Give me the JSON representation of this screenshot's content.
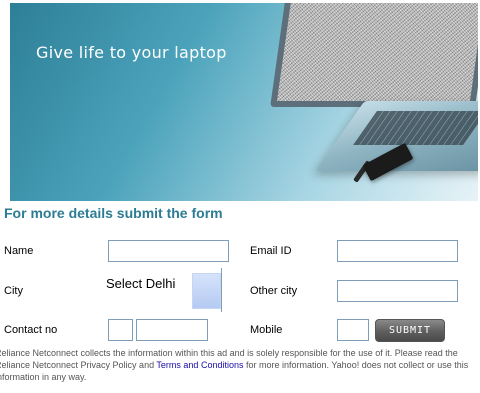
{
  "banner": {
    "title": "Give life to your laptop"
  },
  "form": {
    "heading": "For more details submit the form",
    "name_label": "Name",
    "email_label": "Email ID",
    "city_label": "City",
    "city_select_value": "Select Delhi",
    "other_city_label": "Other city",
    "contact_label": "Contact no",
    "mobile_label": "Mobile",
    "submit_label": "SUBMIT"
  },
  "disclaimer": {
    "text_before_link": "Reliance Netconnect collects the information within this ad and is solely responsible for the use of it. Please read the Reliance Netconnect Privacy Policy and ",
    "link_text": "Terms and Conditions",
    "text_after_link": " for more information. Yahoo! does not collect or use this information in any way."
  }
}
